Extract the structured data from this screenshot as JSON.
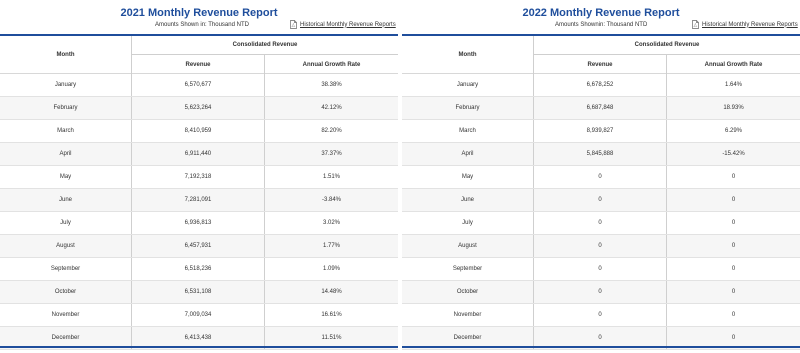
{
  "reports": [
    {
      "title": "2021 Monthly Revenue Report",
      "amounts": "Amounts Shown in: Thousand NTD",
      "history_link": "Historical Monthly Revenue Reports",
      "headers": {
        "month": "Month",
        "consolidated": "Consolidated Revenue",
        "revenue": "Revenue",
        "growth": "Annual Growth Rate"
      },
      "rows": [
        {
          "month": "January",
          "revenue": "6,570,677",
          "growth": "38.38%"
        },
        {
          "month": "February",
          "revenue": "5,623,264",
          "growth": "42.12%"
        },
        {
          "month": "March",
          "revenue": "8,410,959",
          "growth": "82.20%"
        },
        {
          "month": "April",
          "revenue": "6,911,440",
          "growth": "37.37%"
        },
        {
          "month": "May",
          "revenue": "7,192,318",
          "growth": "1.51%"
        },
        {
          "month": "June",
          "revenue": "7,281,091",
          "growth": "-3.84%"
        },
        {
          "month": "July",
          "revenue": "6,936,813",
          "growth": "3.02%"
        },
        {
          "month": "August",
          "revenue": "6,457,931",
          "growth": "1.77%"
        },
        {
          "month": "September",
          "revenue": "6,518,236",
          "growth": "1.09%"
        },
        {
          "month": "October",
          "revenue": "6,531,108",
          "growth": "14.48%"
        },
        {
          "month": "November",
          "revenue": "7,009,034",
          "growth": "16.61%"
        },
        {
          "month": "December",
          "revenue": "6,413,438",
          "growth": "11.51%"
        }
      ]
    },
    {
      "title": "2022 Monthly Revenue Report",
      "amounts": "Amounts Shownin: Thousand NTD",
      "history_link": "Historical Monthly Revenue Reports",
      "headers": {
        "month": "Month",
        "consolidated": "Consolidated Revenue",
        "revenue": "Revenue",
        "growth": "Annual Growth Rate"
      },
      "rows": [
        {
          "month": "January",
          "revenue": "6,678,252",
          "growth": "1.64%"
        },
        {
          "month": "February",
          "revenue": "6,687,848",
          "growth": "18.93%"
        },
        {
          "month": "March",
          "revenue": "8,939,827",
          "growth": "6.29%"
        },
        {
          "month": "April",
          "revenue": "5,845,888",
          "growth": "-15.42%"
        },
        {
          "month": "May",
          "revenue": "0",
          "growth": "0"
        },
        {
          "month": "June",
          "revenue": "0",
          "growth": "0"
        },
        {
          "month": "July",
          "revenue": "0",
          "growth": "0"
        },
        {
          "month": "August",
          "revenue": "0",
          "growth": "0"
        },
        {
          "month": "September",
          "revenue": "0",
          "growth": "0"
        },
        {
          "month": "October",
          "revenue": "0",
          "growth": "0"
        },
        {
          "month": "November",
          "revenue": "0",
          "growth": "0"
        },
        {
          "month": "December",
          "revenue": "0",
          "growth": "0"
        }
      ]
    }
  ],
  "icons": {
    "history_link_icon": "pdf-file-icon"
  },
  "colors": {
    "accent": "#1f4e9c",
    "row_alt": "#f6f6f6"
  }
}
